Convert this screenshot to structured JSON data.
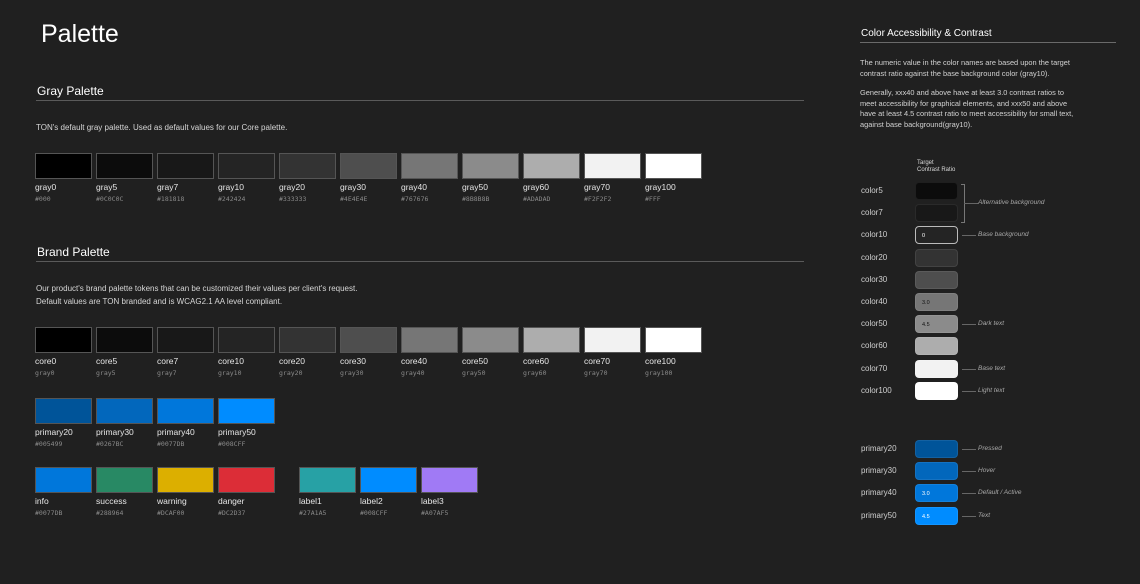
{
  "page_title": "Palette",
  "gray_section": {
    "heading": "Gray Palette",
    "description": "TON's default gray palette. Used as default values for our Core palette.",
    "swatches": [
      {
        "name": "gray0",
        "value": "#000",
        "color": "#000000"
      },
      {
        "name": "gray5",
        "value": "#0C0C0C",
        "color": "#0C0C0C"
      },
      {
        "name": "gray7",
        "value": "#181818",
        "color": "#181818"
      },
      {
        "name": "gray10",
        "value": "#242424",
        "color": "#242424"
      },
      {
        "name": "gray20",
        "value": "#333333",
        "color": "#333333"
      },
      {
        "name": "gray30",
        "value": "#4E4E4E",
        "color": "#4E4E4E"
      },
      {
        "name": "gray40",
        "value": "#767676",
        "color": "#767676"
      },
      {
        "name": "gray50",
        "value": "#8B8B8B",
        "color": "#8B8B8B"
      },
      {
        "name": "gray60",
        "value": "#ADADAD",
        "color": "#ADADAD"
      },
      {
        "name": "gray70",
        "value": "#F2F2F2",
        "color": "#F2F2F2"
      },
      {
        "name": "gray100",
        "value": "#FFF",
        "color": "#FFFFFF"
      }
    ]
  },
  "brand_section": {
    "heading": "Brand Palette",
    "description_line1": "Our product's brand palette tokens that can be customized their values per client's request.",
    "description_line2": "Default values are TON branded and is WCAG2.1 AA level compliant.",
    "core_swatches": [
      {
        "name": "core0",
        "value": "gray0",
        "color": "#000000"
      },
      {
        "name": "core5",
        "value": "gray5",
        "color": "#0C0C0C"
      },
      {
        "name": "core7",
        "value": "gray7",
        "color": "#181818"
      },
      {
        "name": "core10",
        "value": "gray10",
        "color": "#242424"
      },
      {
        "name": "core20",
        "value": "gray20",
        "color": "#333333"
      },
      {
        "name": "core30",
        "value": "gray30",
        "color": "#4E4E4E"
      },
      {
        "name": "core40",
        "value": "gray40",
        "color": "#767676"
      },
      {
        "name": "core50",
        "value": "gray50",
        "color": "#8B8B8B"
      },
      {
        "name": "core60",
        "value": "gray60",
        "color": "#ADADAD"
      },
      {
        "name": "core70",
        "value": "gray70",
        "color": "#F2F2F2"
      },
      {
        "name": "core100",
        "value": "gray100",
        "color": "#FFFFFF"
      }
    ],
    "primary_swatches": [
      {
        "name": "primary20",
        "value": "#005499",
        "color": "#005499"
      },
      {
        "name": "primary30",
        "value": "#0267BC",
        "color": "#0267BC"
      },
      {
        "name": "primary40",
        "value": "#0077DB",
        "color": "#0077DB"
      },
      {
        "name": "primary50",
        "value": "#008CFF",
        "color": "#008CFF"
      }
    ],
    "status_swatches": [
      {
        "name": "info",
        "value": "#0077DB",
        "color": "#0077DB"
      },
      {
        "name": "success",
        "value": "#288964",
        "color": "#288964"
      },
      {
        "name": "warning",
        "value": "#DCAF00",
        "color": "#DCAF00"
      },
      {
        "name": "danger",
        "value": "#DC2D37",
        "color": "#DC2D37"
      }
    ],
    "label_swatches": [
      {
        "name": "label1",
        "value": "#27A1A5",
        "color": "#27A1A5"
      },
      {
        "name": "label2",
        "value": "#008CFF",
        "color": "#008CFF"
      },
      {
        "name": "label3",
        "value": "#A07AF5",
        "color": "#A07AF5"
      }
    ]
  },
  "accessibility": {
    "heading": "Color Accessibility & Contrast",
    "para1_line1": "The numeric value in the color names are based upon the target",
    "para1_line2": "contrast ratio against the base background color (gray10).",
    "para2_line1": "Generally, xxx40 and above have at least 3.0 contrast ratios to",
    "para2_line2": "meet accessibility for graphical elements, and xxx50 and above",
    "para2_line3": "have at least 4.5 contrast ratio to meet accessibility for small text,",
    "para2_line4": "against base background(gray10).",
    "column_head_line1": "Target",
    "column_head_line2": "Contrast Ratio",
    "core_rows": [
      {
        "label": "color5",
        "chip_color": "#0C0C0C",
        "chip_text": "",
        "note": ""
      },
      {
        "label": "color7",
        "chip_color": "#181818",
        "chip_text": "",
        "note": ""
      },
      {
        "label": "color10",
        "chip_color": "#242424",
        "chip_text": "0",
        "note": "Base background"
      },
      {
        "label": "color20",
        "chip_color": "#333333",
        "chip_text": "",
        "note": ""
      },
      {
        "label": "color30",
        "chip_color": "#4E4E4E",
        "chip_text": "",
        "note": ""
      },
      {
        "label": "color40",
        "chip_color": "#767676",
        "chip_text": "3.0",
        "note": ""
      },
      {
        "label": "color50",
        "chip_color": "#8B8B8B",
        "chip_text": "4.5",
        "note": "Dark text"
      },
      {
        "label": "color60",
        "chip_color": "#ADADAD",
        "chip_text": "",
        "note": ""
      },
      {
        "label": "color70",
        "chip_color": "#F2F2F2",
        "chip_text": "",
        "note": "Base text"
      },
      {
        "label": "color100",
        "chip_color": "#FFFFFF",
        "chip_text": "",
        "note": "Light text"
      }
    ],
    "alt_background_note": "Alternative background",
    "primary_rows": [
      {
        "label": "primary20",
        "chip_color": "#005499",
        "chip_text": "",
        "note": "Pressed"
      },
      {
        "label": "primary30",
        "chip_color": "#0267BC",
        "chip_text": "",
        "note": "Hover"
      },
      {
        "label": "primary40",
        "chip_color": "#0077DB",
        "chip_text": "3.0",
        "note": "Default / Active"
      },
      {
        "label": "primary50",
        "chip_color": "#008CFF",
        "chip_text": "4.5",
        "note": "Text"
      }
    ]
  }
}
